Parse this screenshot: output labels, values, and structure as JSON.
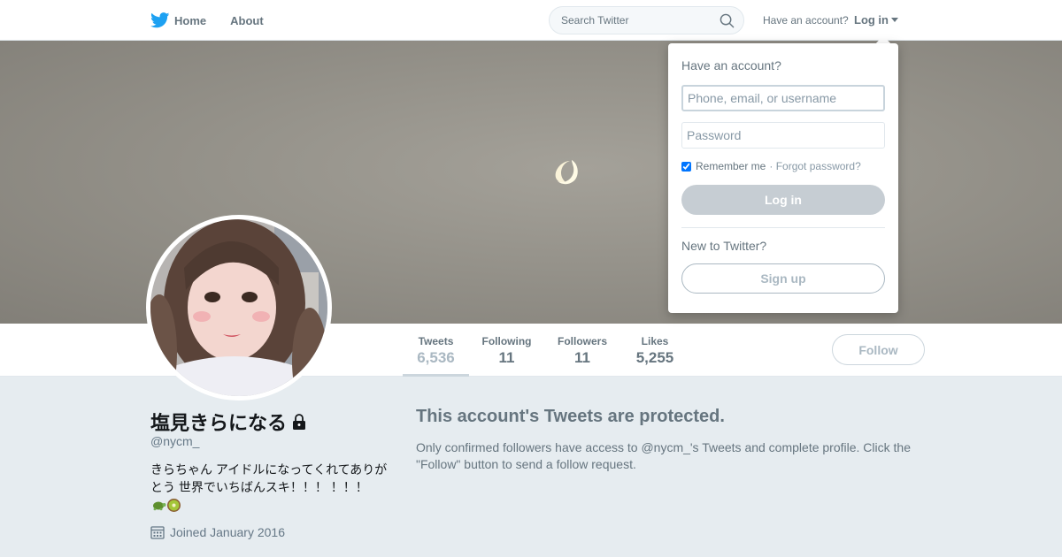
{
  "nav": {
    "home_label": "Home",
    "about_label": "About",
    "search_placeholder": "Search Twitter",
    "have_account": "Have an account?",
    "login_label": "Log in",
    "brand_color": "#1da1f2"
  },
  "profile": {
    "name": "塩見きらになる",
    "handle": "@nycm_",
    "bio_text": "きらちゃん アイドルになってくれてありがとう 世界でいちばんスキ！！！ ！！！",
    "joined": "Joined January 2016",
    "protected": true
  },
  "stats": [
    {
      "label": "Tweets",
      "value": "6,536",
      "active": true
    },
    {
      "label": "Following",
      "value": "11"
    },
    {
      "label": "Followers",
      "value": "11"
    },
    {
      "label": "Likes",
      "value": "5,255"
    }
  ],
  "follow_label": "Follow",
  "protected_message": {
    "title": "This account's Tweets are protected.",
    "text": "Only confirmed followers have access to @nycm_'s Tweets and complete profile. Click the \"Follow\" button to send a follow request."
  },
  "login_dropdown": {
    "heading": "Have an account?",
    "username_placeholder": "Phone, email, or username",
    "password_placeholder": "Password",
    "remember_label": "Remember me",
    "remember_checked": true,
    "separator": "·",
    "forgot_label": "Forgot password?",
    "login_button": "Log in",
    "new_to_twitter": "New to Twitter?",
    "signup_button": "Sign up"
  },
  "icons": [
    "twitter-bird-icon",
    "search-icon",
    "chevron-down-icon",
    "lock-icon",
    "calendar-icon",
    "turtle-emoji-icon",
    "kiwi-emoji-icon"
  ]
}
